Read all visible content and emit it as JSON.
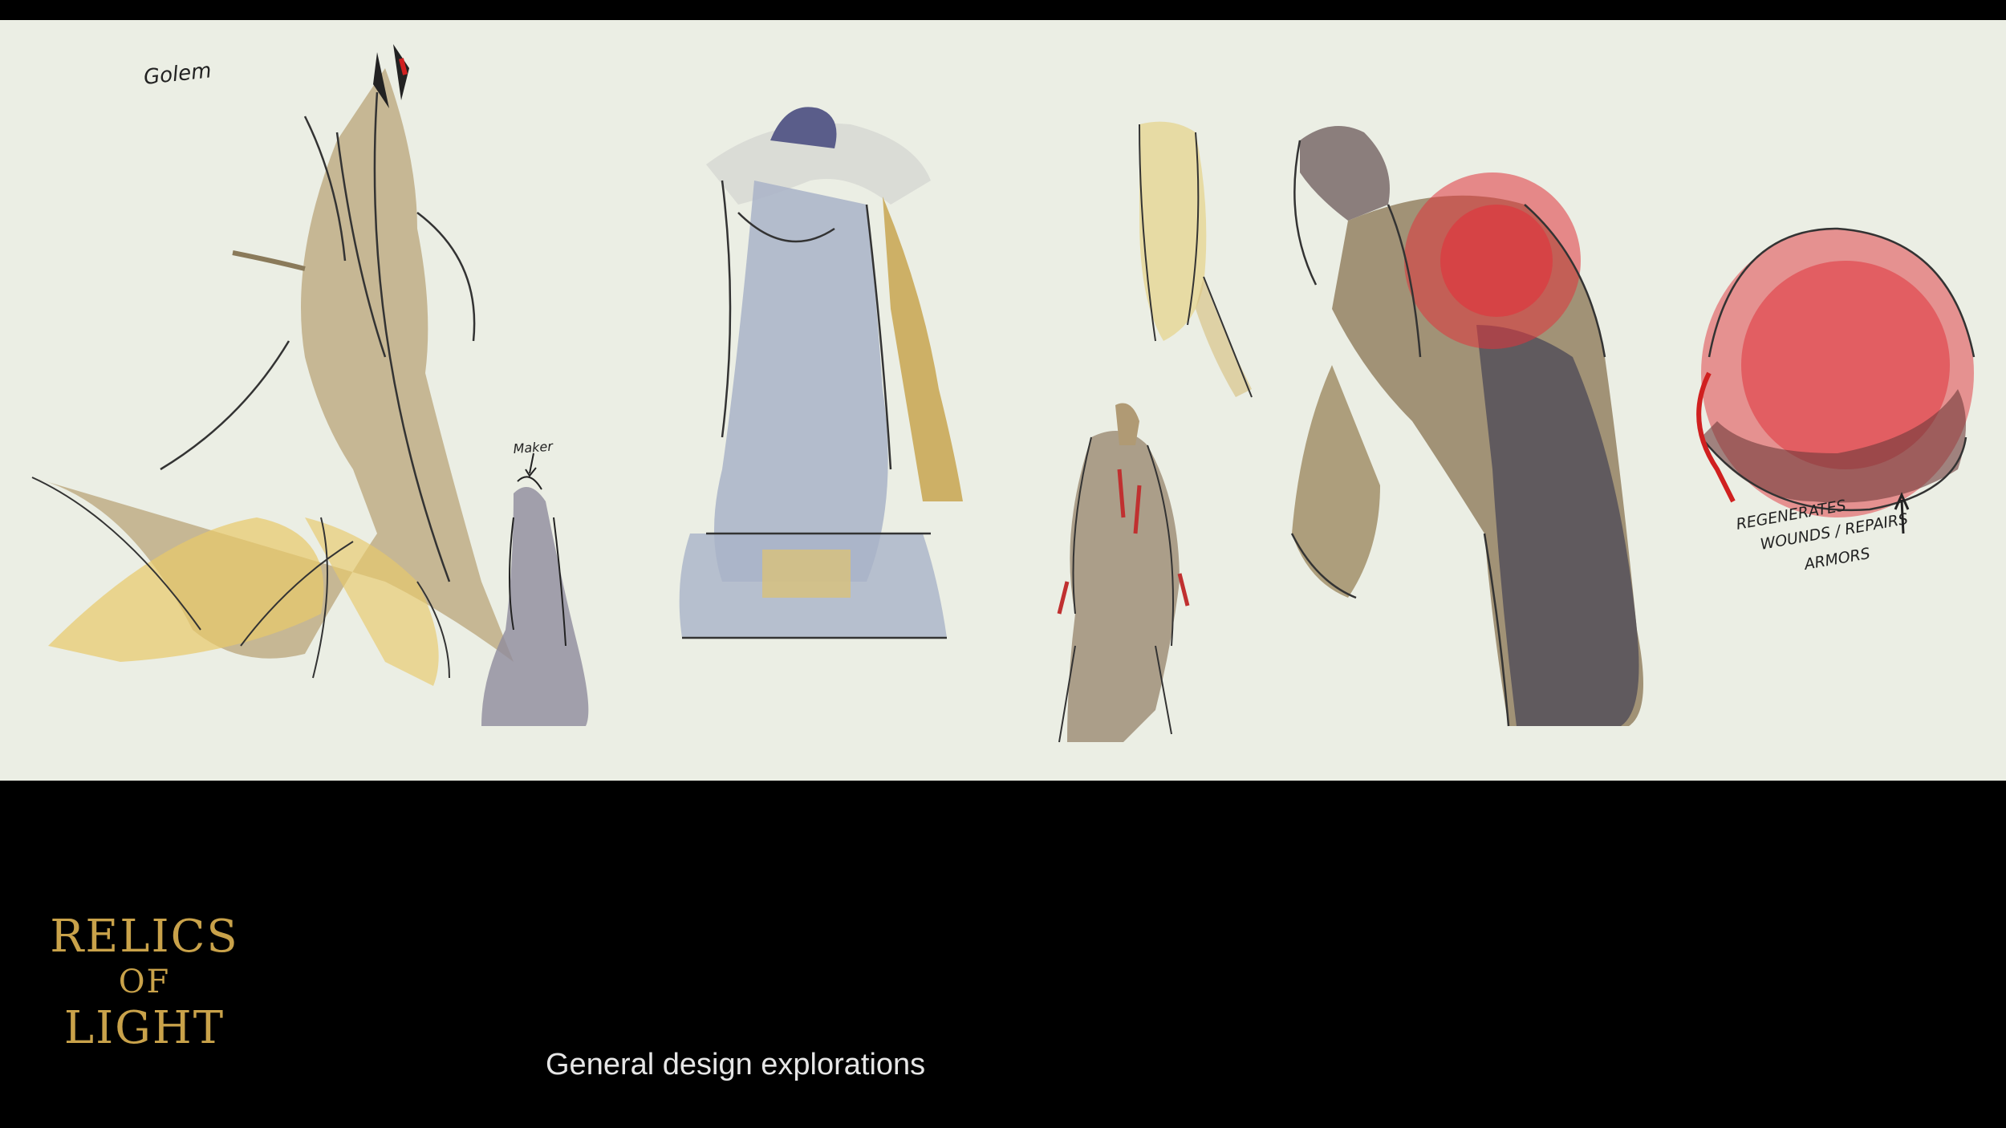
{
  "sketch_notes": {
    "golem": "Golem",
    "maker": "Maker",
    "regen_line1": "REGENERATES",
    "regen_line2": "WOUNDS / REPAIRS",
    "regen_line3": "ARMORS"
  },
  "logo": {
    "line1": "RELICS",
    "line2": "OF",
    "line3": "LIGHT"
  },
  "caption": "General design explorations",
  "colors": {
    "background": "#000000",
    "paper": "#ebeee4",
    "logo_gold": "#c9a24a",
    "caption_text": "#e6e6e6",
    "ink": "#222222",
    "ochre": "#c8a450",
    "blue_grey": "#a9b3c8",
    "red_glow": "#e0343c",
    "brown": "#8a6a40"
  }
}
